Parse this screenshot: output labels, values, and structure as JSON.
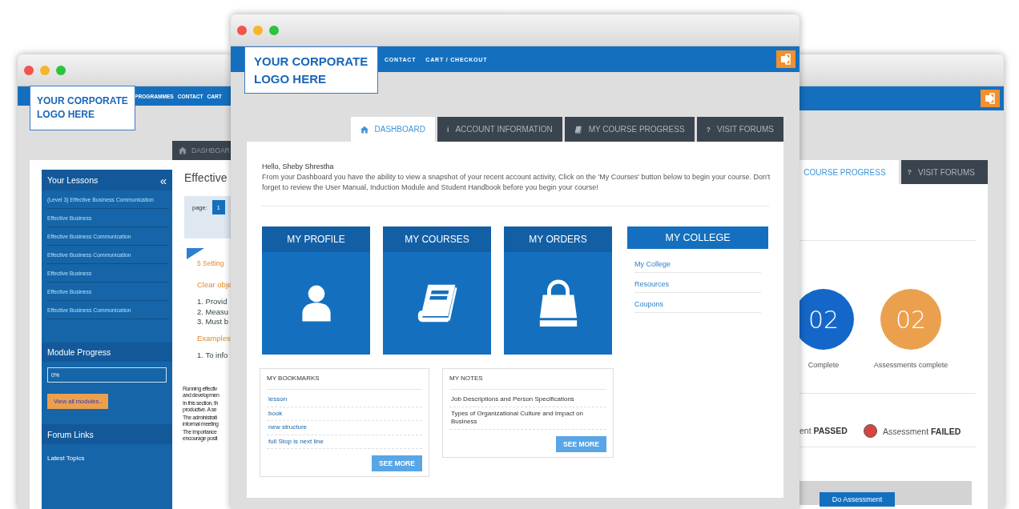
{
  "left_window": {
    "logo": "YOUR CORPORATE LOGO HERE",
    "nav": [
      "PROGRAMMES",
      "CONTACT",
      "CART"
    ],
    "tabs": [
      {
        "kind": "home",
        "label": "DASHBOAR",
        "selected": false
      }
    ],
    "sidebar": {
      "title": "Your Lessons",
      "collapse": "«",
      "lessons": [
        "(Level 3) Effective Business Communication",
        "Effective Business",
        "Effective Business Communication",
        "Effective Business Communication",
        "Effective Business",
        "Effective Business",
        "Effective Business Communication"
      ],
      "progress_title": "Module Progress",
      "progress": {
        "text": "0%",
        "level": 0
      },
      "button": "View all modules..",
      "forum_title": "Forum Links",
      "forum_links": [
        "Latest Topics"
      ]
    },
    "heading": "Effective",
    "pagination": {
      "label": "page:",
      "pages": [
        {
          "label": "1",
          "selected": true
        }
      ]
    },
    "document": [
      {
        "kind": "heading",
        "text": "5 Setting"
      },
      {
        "kind": "subheading",
        "text": "Clear obje"
      },
      {
        "kind": "item",
        "text": "1. Provid"
      },
      {
        "kind": "item",
        "text": "2. Measu"
      },
      {
        "kind": "item",
        "text": "3. Must b"
      },
      {
        "kind": "subheading",
        "text": "Examples"
      },
      {
        "kind": "item",
        "text": "1. To info"
      }
    ],
    "paragraphs": [
      {
        "lines": [
          "Running effectiv",
          "and developmen"
        ]
      },
      {
        "lines": [
          "In this section, th",
          "productive. A se"
        ]
      },
      {
        "lines": [
          "The administrati",
          "informal meeting"
        ]
      },
      {
        "lines": [
          "The importance",
          "encourage posit"
        ]
      }
    ]
  },
  "main_window": {
    "logo": "YOUR CORPORATE LOGO HERE",
    "nav": [
      "CONTACT",
      "CART / CHECKOUT"
    ],
    "tabs": [
      {
        "kind": "home",
        "label": "DASHBOARD",
        "selected": true
      },
      {
        "glyph": "i",
        "label": "ACCOUNT INFORMATION",
        "selected": false
      },
      {
        "kind": "book",
        "label": "MY COURSE PROGRESS",
        "selected": false
      },
      {
        "glyph": "?",
        "label": "VISIT FORUMS",
        "selected": false
      }
    ],
    "greeting": "Hello, Sheby Shrestha",
    "intro": "From your Dashboard you have the ability to view a snapshot of your recent account activity, Click on the 'My Courses' button below to begin your course. Don't forget to review the User Manual, Induction Module and Student Handbook before you begin your course!",
    "tiles": [
      {
        "title": "MY PROFILE",
        "kind": "person"
      },
      {
        "title": "MY COURSES",
        "kind": "book"
      },
      {
        "title": "MY ORDERS",
        "kind": "bag"
      }
    ],
    "college": {
      "title": "MY COLLEGE",
      "links": [
        "My College",
        "Resources",
        "Coupons"
      ]
    },
    "bookmarks": {
      "title": "MY BOOKMARKS",
      "items": [
        "lesson",
        "book",
        "new structure",
        "full Stop is next line"
      ],
      "button": "SEE MORE"
    },
    "notes": {
      "title": "MY NOTES",
      "items": [
        "Job Descriptions and Person Specifications",
        "Types of Organizational Culture and Impact on Business"
      ],
      "button": "SEE MORE"
    }
  },
  "right_window": {
    "tabs": [
      {
        "label": "COURSE PROGRESS",
        "selected": true
      },
      {
        "glyph": "?",
        "label": "VISIT FORUMS",
        "selected": false
      }
    ],
    "stats": [
      {
        "value": "02",
        "label": "Complete",
        "color": "#1467c8"
      },
      {
        "value": "02",
        "label": "Assessments complete",
        "color": "#eba04e"
      }
    ],
    "legend": [
      {
        "text": "ent **PASSED**"
      },
      {
        "text": "Assessment **FAILED**",
        "color": "#d64541"
      }
    ],
    "action": "Do Assessment"
  }
}
